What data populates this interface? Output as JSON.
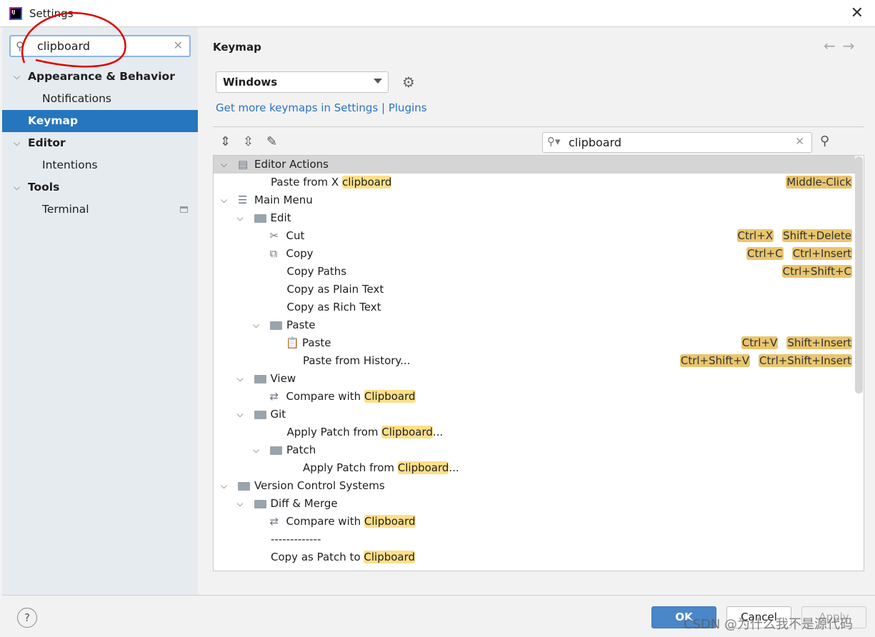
{
  "window": {
    "title": "Settings"
  },
  "sidebar": {
    "search": "clipboard",
    "items": [
      {
        "label": "Appearance & Behavior",
        "level": 0,
        "bold": true,
        "expanded": true
      },
      {
        "label": "Notifications",
        "level": 1
      },
      {
        "label": "Keymap",
        "level": 0,
        "bold": true,
        "selected": true
      },
      {
        "label": "Editor",
        "level": 0,
        "bold": true,
        "expanded": true
      },
      {
        "label": "Intentions",
        "level": 1
      },
      {
        "label": "Tools",
        "level": 0,
        "bold": true,
        "expanded": true
      },
      {
        "label": "Terminal",
        "level": 1
      }
    ]
  },
  "main": {
    "title": "Keymap",
    "keymap": "Windows",
    "link": "Get more keymaps in Settings | Plugins",
    "filter": "clipboard"
  },
  "tree": [
    {
      "lvl": 0,
      "exp": true,
      "icon": "editor-actions",
      "text": "Editor Actions",
      "hl": true
    },
    {
      "lvl": 1,
      "text": "Paste from X ",
      "match": "clipboard",
      "keys": [
        "Middle-Click"
      ]
    },
    {
      "lvl": 0,
      "exp": true,
      "icon": "menu",
      "text": "Main Menu"
    },
    {
      "lvl": 1,
      "exp": true,
      "icon": "folder",
      "text": "Edit"
    },
    {
      "lvl": 2,
      "icon": "scissors",
      "text": "Cut",
      "keys": [
        "Ctrl+X",
        "Shift+Delete"
      ]
    },
    {
      "lvl": 2,
      "icon": "copy",
      "text": "Copy",
      "keys": [
        "Ctrl+C",
        "Ctrl+Insert"
      ]
    },
    {
      "lvl": 2,
      "text": "Copy Paths",
      "keys": [
        "Ctrl+Shift+C"
      ]
    },
    {
      "lvl": 2,
      "text": "Copy as Plain Text"
    },
    {
      "lvl": 2,
      "text": "Copy as Rich Text"
    },
    {
      "lvl": 2,
      "exp": true,
      "icon": "folder",
      "text": "Paste"
    },
    {
      "lvl": 3,
      "icon": "clipboard",
      "text": "Paste",
      "keys": [
        "Ctrl+V",
        "Shift+Insert"
      ]
    },
    {
      "lvl": 3,
      "text": "Paste from History...",
      "keys": [
        "Ctrl+Shift+V",
        "Ctrl+Shift+Insert"
      ]
    },
    {
      "lvl": 1,
      "exp": true,
      "icon": "folder",
      "text": "View"
    },
    {
      "lvl": 2,
      "icon": "compare",
      "text": "Compare with ",
      "match": "Clipboard"
    },
    {
      "lvl": 1,
      "exp": true,
      "icon": "folder",
      "text": "Git"
    },
    {
      "lvl": 2,
      "text": "Apply Patch from ",
      "match": "Clipboard",
      "after": "..."
    },
    {
      "lvl": 2,
      "exp": true,
      "icon": "folder",
      "text": "Patch"
    },
    {
      "lvl": 3,
      "text": "Apply Patch from ",
      "match": "Clipboard",
      "after": "..."
    },
    {
      "lvl": 0,
      "exp": true,
      "icon": "folder",
      "text": "Version Control Systems"
    },
    {
      "lvl": 1,
      "exp": true,
      "icon": "folder",
      "text": "Diff & Merge"
    },
    {
      "lvl": 2,
      "icon": "compare",
      "text": "Compare with ",
      "match": "Clipboard"
    },
    {
      "lvl": 1,
      "text": "-------------"
    },
    {
      "lvl": 1,
      "text": "Copy as Patch to ",
      "match": "Clipboard"
    }
  ],
  "footer": {
    "ok": "OK",
    "cancel": "Cancel",
    "apply": "Apply",
    "help": "?"
  },
  "watermark": "CSDN @为什么我不是源代码",
  "colors": {
    "selection": "#2675bf",
    "match": "#fddf8a",
    "shortcut": "#e9c56e",
    "annotation": "#e00000"
  }
}
